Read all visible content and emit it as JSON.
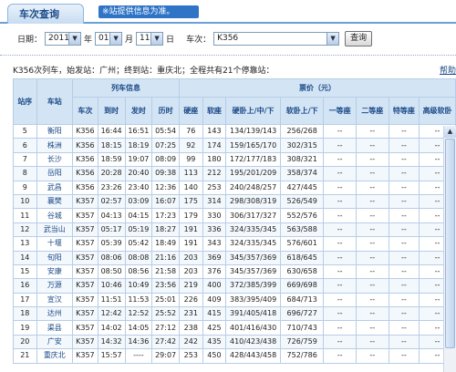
{
  "header": {
    "tab_title": "车次查询",
    "banner_text": "※站提供信息为准。"
  },
  "search": {
    "date_label": "日期：",
    "year": "2011",
    "year_unit": "年",
    "month": "01",
    "month_unit": "月",
    "day": "11",
    "day_unit": "日",
    "train_label": "车次：",
    "train_value": "K356",
    "query_button": "查询"
  },
  "info_line": "K356次列车，始发站：广州；终到站：重庆北；全程共有21个停靠站：",
  "help_link": "帮助",
  "table": {
    "group_headers": {
      "seq": "站序",
      "station": "车站",
      "train_info": "列车信息",
      "price": "票价（元）"
    },
    "columns": [
      "车次",
      "到时",
      "发时",
      "历时",
      "硬座",
      "软座",
      "硬卧上/中/下",
      "软卧上/下",
      "一等座",
      "二等座",
      "特等座",
      "高级软卧"
    ],
    "rows": [
      [
        "5",
        "衡阳",
        "K356",
        "16:44",
        "16:51",
        "05:54",
        "76",
        "143",
        "134/139/143",
        "256/268",
        "--",
        "--",
        "--",
        "--"
      ],
      [
        "6",
        "株洲",
        "K356",
        "18:15",
        "18:19",
        "07:25",
        "92",
        "174",
        "159/165/170",
        "302/315",
        "--",
        "--",
        "--",
        "--"
      ],
      [
        "7",
        "长沙",
        "K356",
        "18:59",
        "19:07",
        "08:09",
        "99",
        "180",
        "172/177/183",
        "308/321",
        "--",
        "--",
        "--",
        "--"
      ],
      [
        "8",
        "岳阳",
        "K356",
        "20:28",
        "20:40",
        "09:38",
        "113",
        "212",
        "195/201/209",
        "358/374",
        "--",
        "--",
        "--",
        "--"
      ],
      [
        "9",
        "武昌",
        "K356",
        "23:26",
        "23:40",
        "12:36",
        "140",
        "253",
        "240/248/257",
        "427/445",
        "--",
        "--",
        "--",
        "--"
      ],
      [
        "10",
        "襄樊",
        "K357",
        "02:57",
        "03:09",
        "16:07",
        "175",
        "314",
        "298/308/319",
        "526/549",
        "--",
        "--",
        "--",
        "--"
      ],
      [
        "11",
        "谷城",
        "K357",
        "04:13",
        "04:15",
        "17:23",
        "179",
        "330",
        "306/317/327",
        "552/576",
        "--",
        "--",
        "--",
        "--"
      ],
      [
        "12",
        "武当山",
        "K357",
        "05:17",
        "05:19",
        "18:27",
        "191",
        "336",
        "324/335/345",
        "563/588",
        "--",
        "--",
        "--",
        "--"
      ],
      [
        "13",
        "十堰",
        "K357",
        "05:39",
        "05:42",
        "18:49",
        "191",
        "343",
        "324/335/345",
        "576/601",
        "--",
        "--",
        "--",
        "--"
      ],
      [
        "14",
        "旬阳",
        "K357",
        "08:06",
        "08:08",
        "21:16",
        "203",
        "369",
        "345/357/369",
        "618/645",
        "--",
        "--",
        "--",
        "--"
      ],
      [
        "15",
        "安康",
        "K357",
        "08:50",
        "08:56",
        "21:58",
        "203",
        "376",
        "345/357/369",
        "630/658",
        "--",
        "--",
        "--",
        "--"
      ],
      [
        "16",
        "万源",
        "K357",
        "10:46",
        "10:49",
        "23:56",
        "219",
        "400",
        "372/385/399",
        "669/698",
        "--",
        "--",
        "--",
        "--"
      ],
      [
        "17",
        "宣汉",
        "K357",
        "11:51",
        "11:53",
        "25:01",
        "226",
        "409",
        "383/395/409",
        "684/713",
        "--",
        "--",
        "--",
        "--"
      ],
      [
        "18",
        "达州",
        "K357",
        "12:42",
        "12:52",
        "25:52",
        "231",
        "415",
        "391/405/418",
        "696/727",
        "--",
        "--",
        "--",
        "--"
      ],
      [
        "19",
        "渠县",
        "K357",
        "14:02",
        "14:05",
        "27:12",
        "238",
        "425",
        "401/416/430",
        "710/743",
        "--",
        "--",
        "--",
        "--"
      ],
      [
        "20",
        "广安",
        "K357",
        "14:32",
        "14:36",
        "27:42",
        "242",
        "435",
        "410/423/438",
        "726/759",
        "--",
        "--",
        "--",
        "--"
      ],
      [
        "21",
        "重庆北",
        "K357",
        "15:57",
        "----",
        "29:07",
        "253",
        "450",
        "428/443/458",
        "752/786",
        "--",
        "--",
        "--",
        "--"
      ]
    ]
  },
  "icons": {
    "dropdown": "chevron-down-icon",
    "scroll_up": "arrow-up-icon"
  }
}
